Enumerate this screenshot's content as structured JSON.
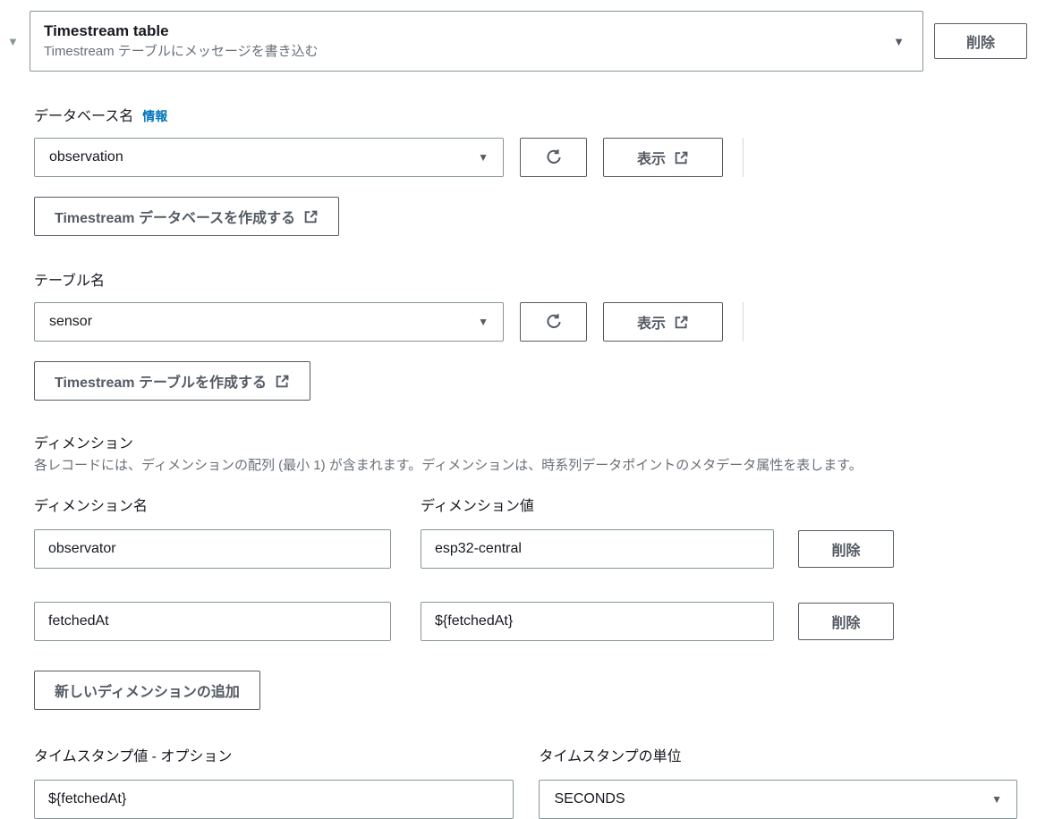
{
  "colors": {
    "text": "#16191f",
    "muted_text": "#687078",
    "control_border": "#879596",
    "button_color": "#545b64",
    "link_blue": "#0073bb",
    "divider": "#d5dbdb"
  },
  "icons": {
    "collapse_caret": "▼",
    "dropdown_caret": "▼"
  },
  "header": {
    "title": "Timestream table",
    "subtitle": "Timestream テーブルにメッセージを書き込む",
    "delete_label": "削除"
  },
  "database": {
    "label": "データベース名",
    "info_link": "情報",
    "selected": "observation",
    "view_label": "表示",
    "create_label": "Timestream データベースを作成する"
  },
  "table": {
    "label": "テーブル名",
    "selected": "sensor",
    "view_label": "表示",
    "create_label": "Timestream テーブルを作成する"
  },
  "dimensions": {
    "title": "ディメンション",
    "description": "各レコードには、ディメンションの配列 (最小 1) が含まれます。ディメンションは、時系列データポイントのメタデータ属性を表します。",
    "name_header": "ディメンション名",
    "value_header": "ディメンション値",
    "delete_label": "削除",
    "rows": [
      {
        "name": "observator",
        "value": "esp32-central"
      },
      {
        "name": "fetchedAt",
        "value": "${fetchedAt}"
      }
    ],
    "add_label": "新しいディメンションの追加"
  },
  "timestamp": {
    "value_label": "タイムスタンプ値 - オプション",
    "value": "${fetchedAt}",
    "unit_label": "タイムスタンプの単位",
    "unit": "SECONDS"
  }
}
